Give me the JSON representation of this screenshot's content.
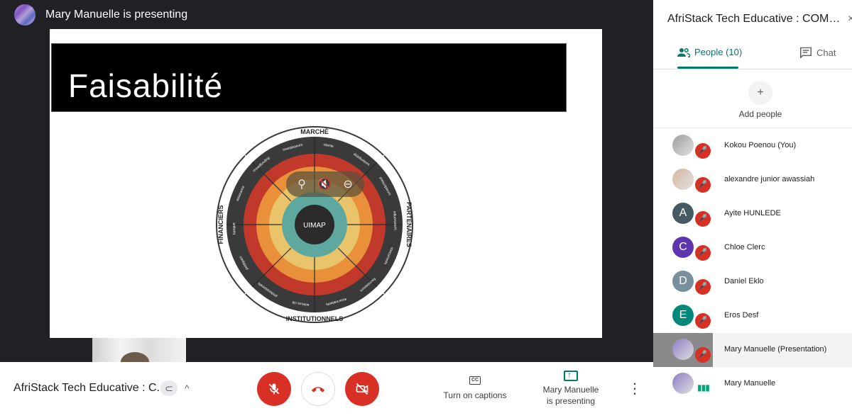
{
  "presenter_bar": {
    "text": "Mary Manuelle is presenting"
  },
  "slide": {
    "title": "Faisabilité",
    "wheel": {
      "top_label": "MARCHÉ",
      "right_label": "PARTENAIRES",
      "bottom_label": "INSTITUTIONNELS",
      "left_label": "FINANCIERS",
      "center_label": "UIMAP",
      "segment_labels": [
        "clients",
        "distributeurs",
        "prescripteurs",
        "influenceurs",
        "concurrents",
        "fournisseurs",
        "sous-traitants",
        "acteurs clé",
        "professionnels",
        "politiques",
        "banque",
        "assurance",
        "crowdfunding",
        "investisseurs"
      ],
      "colors": {
        "outer": "#3a3a3a",
        "red": "#c0392b",
        "orange": "#e8913a",
        "yellow": "#e9c46a",
        "teal": "#5fa8a0",
        "center": "#2b2b2b"
      }
    }
  },
  "bottom_bar": {
    "meeting_name": "AfriStack Tech Educative : C...",
    "captions_label": "Turn on captions",
    "present_label_1": "Mary Manuelle",
    "present_label_2": "is presenting"
  },
  "panel": {
    "title": "AfriStack Tech Educative : COMM...",
    "tab_people": "People (10)",
    "tab_chat": "Chat",
    "add_people": "Add people",
    "people": [
      {
        "name": "Kokou Poenou (You)",
        "initial": "",
        "color": "#9e9e9e",
        "status": "muted"
      },
      {
        "name": "alexandre junior awassiah",
        "initial": "",
        "color": "#d7b8a0",
        "status": "muted"
      },
      {
        "name": "Ayite HUNLEDE",
        "initial": "A",
        "color": "#455a64",
        "status": "muted"
      },
      {
        "name": "Chloe Clerc",
        "initial": "C",
        "color": "#5e35b1",
        "status": "muted"
      },
      {
        "name": "Daniel Eklo",
        "initial": "D",
        "color": "#78909c",
        "status": "muted"
      },
      {
        "name": "Eros Desf",
        "initial": "E",
        "color": "#00897b",
        "status": "muted"
      },
      {
        "name": "Mary Manuelle (Presentation)",
        "initial": "",
        "color": "#8e7cc3",
        "status": "muted"
      },
      {
        "name": "Mary Manuelle",
        "initial": "",
        "color": "#8e7cc3",
        "status": "speaking"
      }
    ]
  },
  "colors": {
    "accent": "#00796b",
    "danger": "#d93025",
    "stage": "#202124"
  }
}
